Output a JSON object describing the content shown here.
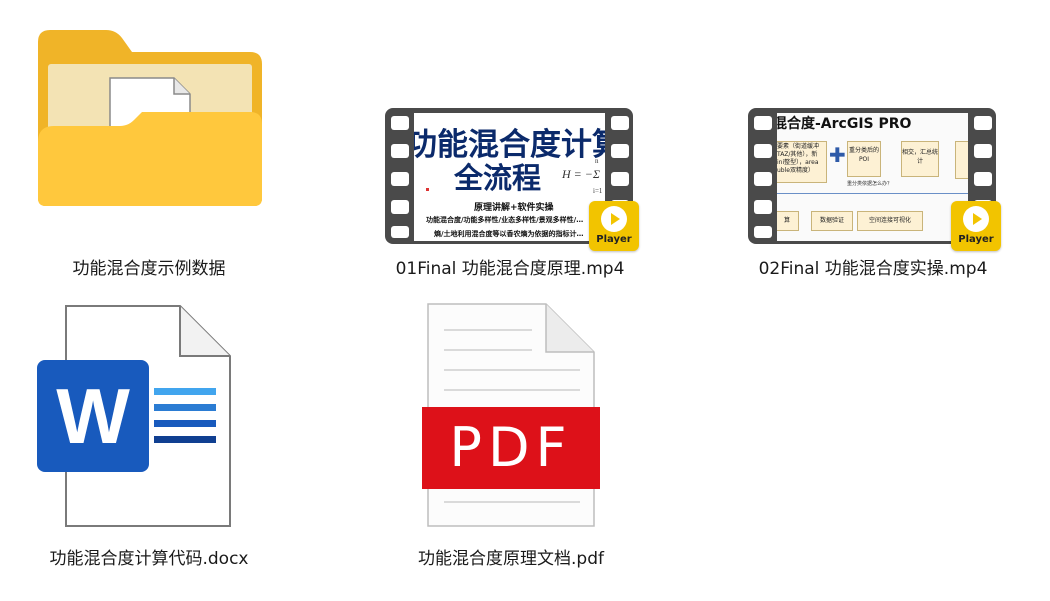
{
  "files": [
    {
      "name": "功能混合度示例数据",
      "type": "folder",
      "icon": "folder-icon"
    },
    {
      "name": "01Final 功能混合度原理.mp4",
      "type": "video",
      "icon": "video-file-icon",
      "thumbnail": {
        "title_line1": "功能混合度计算",
        "title_line2": "全流程",
        "subtitle": "原理讲解+软件实操",
        "line3": "功能混合度/功能多样性/业态多样性/景观多样性/…",
        "line4": "熵/土地利用混合度等以香农熵为依据的指标计…",
        "formula": "H = −Σ",
        "sum_top": "n",
        "sum_bottom": "i=1"
      },
      "badge": "Player"
    },
    {
      "name": "02Final 功能混合度实操.mp4",
      "type": "video",
      "icon": "video-file-icon",
      "thumbnail": {
        "title": "混合度-ArcGIS PRO",
        "box1": "要素（街道缓冲 TAZ/其他），新 ini整型），area uble双精度）",
        "box2": "重分类后的POI",
        "box3": "相交，汇总统计",
        "note": "重分类依据怎么办？",
        "box4": "算",
        "box5": "数据验证",
        "box6": "空间连接可视化"
      },
      "badge": "Player"
    },
    {
      "name": "功能混合度计算代码.docx",
      "type": "word",
      "icon": "word-document-icon",
      "letter": "W"
    },
    {
      "name": "功能混合度原理文档.pdf",
      "type": "pdf",
      "icon": "pdf-document-icon",
      "banner": "PDF"
    }
  ],
  "colors": {
    "folder_back": "#F0B428",
    "folder_front": "#FFC83D",
    "word_blue": "#185ABD",
    "pdf_red": "#DD1119",
    "player_yellow": "#F2C400"
  }
}
